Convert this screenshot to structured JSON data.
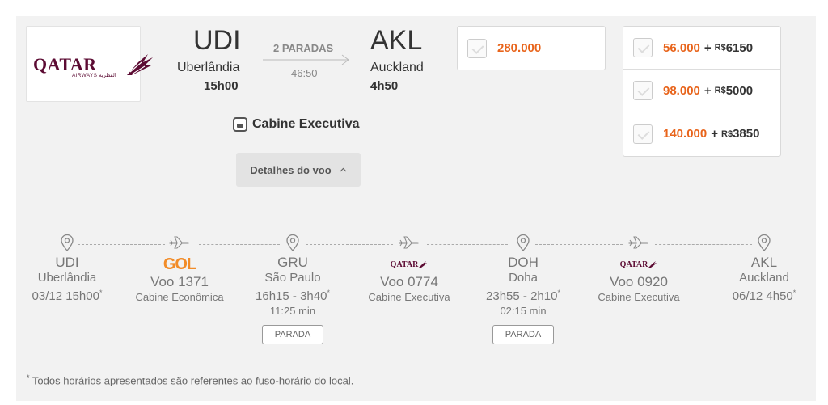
{
  "airline": {
    "name": "QATAR",
    "subtitle": "AIRWAYS القطرية"
  },
  "origin": {
    "code": "UDI",
    "city": "Uberlândia",
    "time": "15h00"
  },
  "destination": {
    "code": "AKL",
    "city": "Auckland",
    "time": "4h50"
  },
  "route": {
    "stops": "2 PARADAS",
    "duration": "46:50"
  },
  "cabin": {
    "label": "Cabine Executiva"
  },
  "details_button": {
    "label": "Detalhes do voo",
    "icon": "chevron-up-icon"
  },
  "prices": {
    "main": {
      "miles": "280.000"
    },
    "options": [
      {
        "miles": "56.000",
        "plus": "+",
        "currency": "R$",
        "amount": "6150"
      },
      {
        "miles": "98.000",
        "plus": "+",
        "currency": "R$",
        "amount": "5000"
      },
      {
        "miles": "140.000",
        "plus": "+",
        "currency": "R$",
        "amount": "3850"
      }
    ]
  },
  "itinerary": {
    "udi": {
      "code": "UDI",
      "city": "Uberlândia",
      "datetime": "03/12 15h00",
      "mark": "*"
    },
    "leg1": {
      "airline": "GOL",
      "flight": "Voo 1371",
      "cabin": "Cabine Econômica"
    },
    "gru": {
      "code": "GRU",
      "city": "São Paulo",
      "times": "16h15 - 3h40",
      "mark": "*",
      "layover": "11:25 min",
      "badge": "PARADA"
    },
    "leg2": {
      "airline": "QATAR",
      "flight": "Voo 0774",
      "cabin": "Cabine Executiva"
    },
    "doh": {
      "code": "DOH",
      "city": "Doha",
      "times": "23h55 - 2h10",
      "mark": "*",
      "layover": "02:15 min",
      "badge": "PARADA"
    },
    "leg3": {
      "airline": "QATAR",
      "flight": "Voo 0920",
      "cabin": "Cabine Executiva"
    },
    "akl": {
      "code": "AKL",
      "city": "Auckland",
      "datetime": "06/12 4h50",
      "mark": "*"
    }
  },
  "footnote": {
    "mark": "*",
    "text": " Todos horários apresentados são referentes ao fuso-horário do local."
  },
  "colors": {
    "miles": "#e8641b",
    "qatar": "#5c0b33",
    "gol": "#f28c28",
    "panel": "#f2f2f2"
  }
}
